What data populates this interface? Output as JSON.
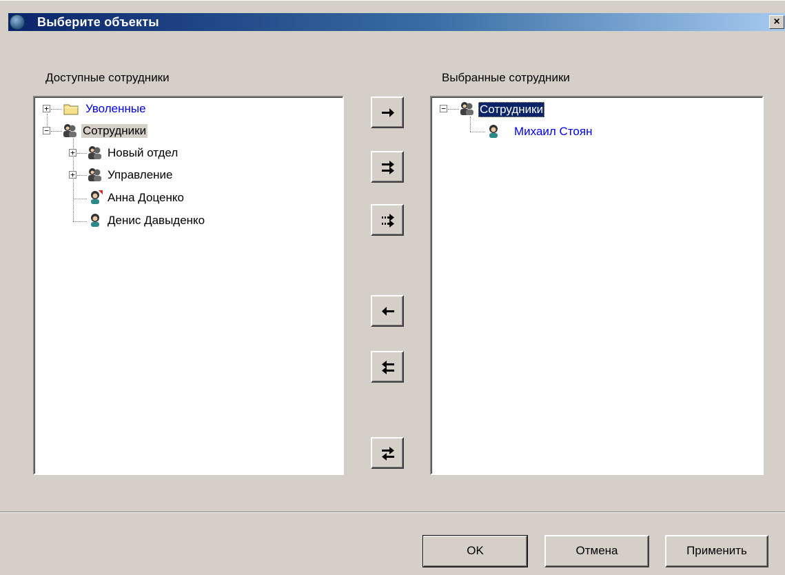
{
  "window": {
    "title": "Выберите объекты",
    "close_label": "×"
  },
  "left_panel": {
    "label": "Доступные сотрудники",
    "tree": [
      {
        "label": "Уволенные",
        "icon": "folder-icon",
        "expander": "+"
      },
      {
        "label": "Сотрудники",
        "icon": "group-icon",
        "expander": "−"
      },
      {
        "label": "Новый отдел",
        "icon": "group-icon",
        "expander": "+"
      },
      {
        "label": "Управление",
        "icon": "group-icon",
        "expander": "+"
      },
      {
        "label": "Анна Доценко",
        "icon": "person-icon"
      },
      {
        "label": "Денис Давыденко",
        "icon": "person-icon"
      }
    ]
  },
  "right_panel": {
    "label": "Выбранные сотрудники",
    "tree": [
      {
        "label": "Сотрудники",
        "icon": "group-icon",
        "expander": "−"
      },
      {
        "label": "Михаил Стоян",
        "icon": "person-icon"
      }
    ]
  },
  "arrow_buttons": [
    {
      "icon": "arrow-right-icon"
    },
    {
      "icon": "double-arrow-right-icon"
    },
    {
      "icon": "dotted-double-arrow-right-icon"
    },
    {
      "icon": "arrow-left-icon"
    },
    {
      "icon": "double-arrow-left-icon"
    },
    {
      "icon": "swap-arrows-icon"
    }
  ],
  "buttons": {
    "ok": "OK",
    "cancel": "Отмена",
    "apply": "Применить"
  },
  "colors": {
    "title_gradient_start": "#0a246a",
    "title_gradient_end": "#a6caf0",
    "link": "#0000ee",
    "dialog_bg": "#d4d0c8"
  }
}
